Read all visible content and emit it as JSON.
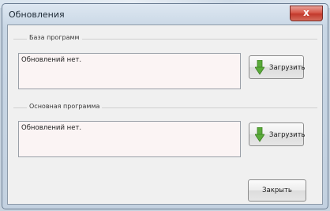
{
  "window": {
    "title": "Обновления",
    "close_glyph": "x"
  },
  "groups": [
    {
      "label": "База программ",
      "text": "Обновлений нет.",
      "button_label": "Загрузить",
      "button_icon": "download-arrow-icon"
    },
    {
      "label": "Основная программа",
      "text": "Обновлений нет.",
      "button_label": "Загрузить",
      "button_icon": "download-arrow-icon"
    }
  ],
  "footer": {
    "close_label": "Закрыть"
  },
  "colors": {
    "accent_green": "#4a9a2e",
    "close_red": "#c2392c"
  }
}
